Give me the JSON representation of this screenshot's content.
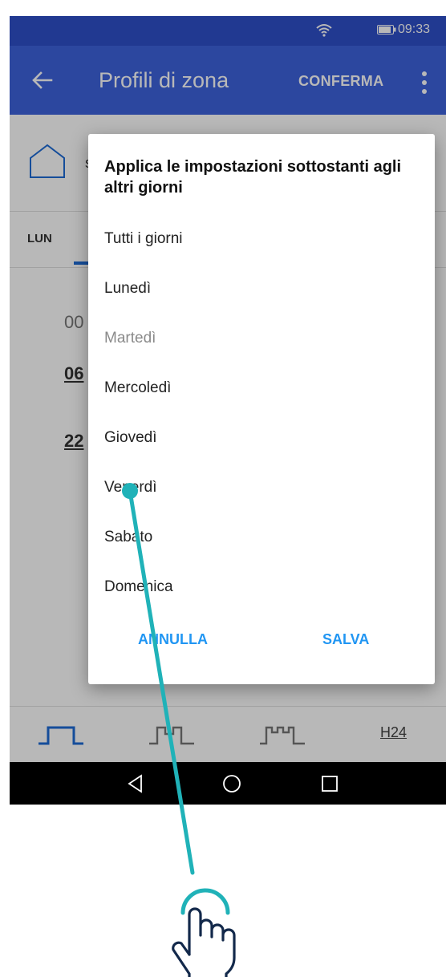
{
  "status_bar": {
    "time": "09:33",
    "icons": [
      "wifi-icon",
      "battery-icon"
    ]
  },
  "app_bar": {
    "title": "Profili di zona",
    "confirm_label": "CONFERMA",
    "icons": [
      "back-arrow-icon",
      "more-vert-icon"
    ]
  },
  "background": {
    "zone_initial": "s",
    "day_tab_first": "LUN",
    "times": [
      "00",
      "06",
      "22"
    ]
  },
  "dialog": {
    "title": "Applica le impostazioni sottostanti agli altri giorni",
    "options": [
      {
        "label": "Tutti i giorni",
        "enabled": true
      },
      {
        "label": "Lunedì",
        "enabled": true
      },
      {
        "label": "Martedì",
        "enabled": false
      },
      {
        "label": "Mercoledì",
        "enabled": true
      },
      {
        "label": "Giovedì",
        "enabled": true
      },
      {
        "label": "Venerdì",
        "enabled": true
      },
      {
        "label": "Sabato",
        "enabled": true
      },
      {
        "label": "Domenica",
        "enabled": true
      }
    ],
    "cancel_label": "ANNULLA",
    "save_label": "SALVA"
  },
  "bottom_bar": {
    "h24_label": "H24"
  },
  "colors": {
    "status_bar": "#2f4fc9",
    "app_bar": "#3d63dd",
    "accent": "#2196f3",
    "tab_indicator": "#1e6bd6",
    "gesture": "#20b2b8",
    "hand_outline": "#13294b"
  }
}
